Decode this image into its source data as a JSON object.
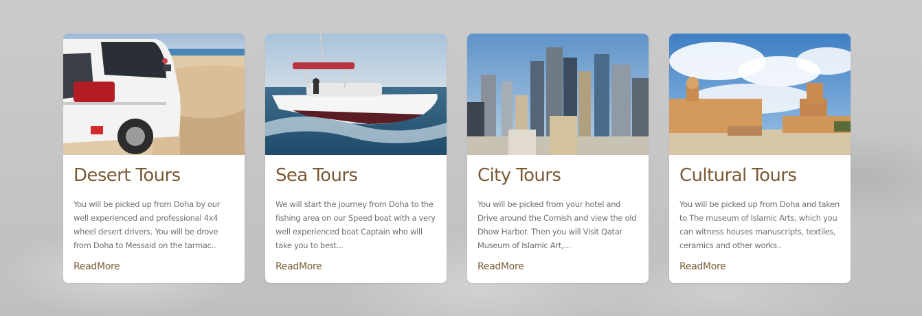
{
  "cards": [
    {
      "title": "Desert Tours",
      "description": "You will be picked up from Doha by our well experienced and professional 4x4 wheel desert drivers. You will be drove from Doha to Messaid on the tarmac..",
      "link": "ReadMore",
      "image": "white-suv-on-desert-beach"
    },
    {
      "title": "Sea Tours",
      "description": "We will start the journey from Doha to the fishing area on our Speed boat with a very well experienced boat Captain who will take you to best...",
      "link": "ReadMore",
      "image": "speed-boat-on-sea"
    },
    {
      "title": "City Tours",
      "description": "You will be picked from your hotel and Drive around the Cornish and view the old Dhow Harbor. Then you will Visit Qatar Museum of Islamic Art,...",
      "link": "ReadMore",
      "image": "doha-city-skyline"
    },
    {
      "title": "Cultural Tours",
      "description": "You will be picked up from Doha and taken to The museum of Islamic Arts, which you can witness houses manuscripts, textiles, ceramics and other works..",
      "link": "ReadMore",
      "image": "desert-fort-under-clouds"
    }
  ],
  "colors": {
    "accent": "#7a5a34",
    "text": "#6f6f6f",
    "background": "#c9c9c9"
  }
}
